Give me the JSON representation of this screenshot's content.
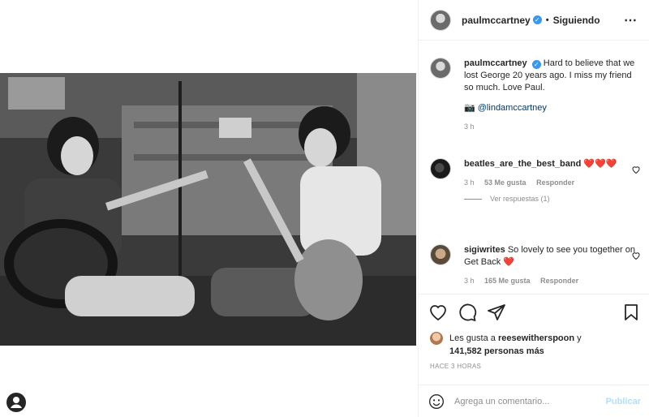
{
  "post": {
    "username": "paulmccartney",
    "verified_badge": "✓",
    "separator": "•",
    "follow_state": "Siguiendo",
    "more_icon": "⋯"
  },
  "caption": {
    "username": "paulmccartney",
    "text": "Hard to believe that we lost George 20 years ago. I miss my friend so much. Love Paul.",
    "camera_icon": "📷",
    "tag": "@lindamccartney",
    "time": "3 h"
  },
  "comments": [
    {
      "username": "beatles_are_the_best_band",
      "text": "❤️❤️❤️",
      "time": "3 h",
      "likes": "53 Me gusta",
      "reply": "Responder",
      "view_replies": "Ver respuestas (1)"
    },
    {
      "username": "sigiwrites",
      "text": "So lovely to see you together on Get Back",
      "heart": "❤️",
      "time": "3 h",
      "likes": "165 Me gusta",
      "reply": "Responder"
    }
  ],
  "likes": {
    "prefix": "Les gusta a",
    "user": "reesewitherspoon",
    "and": "y",
    "count": "141,582 personas más"
  },
  "timeago": "HACE 3 HORAS",
  "comment_box": {
    "placeholder": "Agrega un comentario...",
    "publish": "Publicar"
  },
  "colors": {
    "accent_blue": "#3897f0",
    "heart_red": "#ed4956",
    "publish_disabled": "#b2dffc"
  }
}
